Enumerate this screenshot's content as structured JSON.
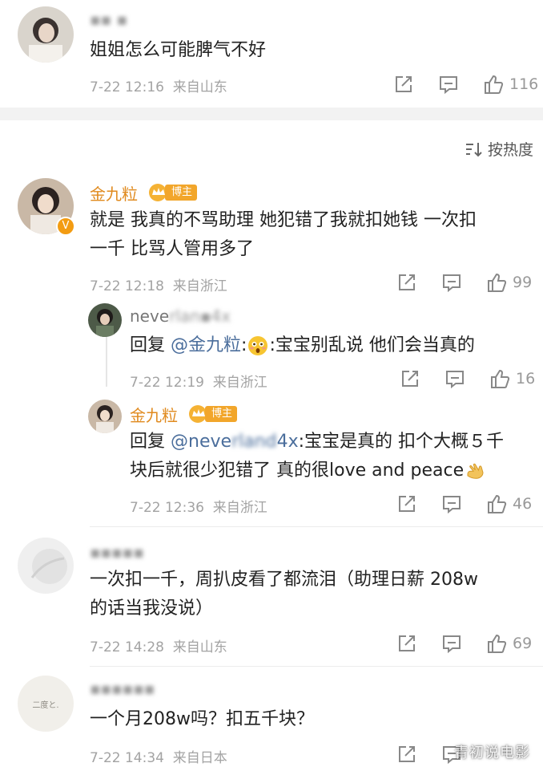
{
  "comments": [
    {
      "name_blurred": "▪▪ ▪",
      "text": "姐姐怎么可能脾气不好",
      "date": "7-22 12:16",
      "location": "来自山东",
      "likes": "116"
    },
    {
      "name": "金九粒",
      "badge": "博主",
      "lines": [
        "就是 我真的不骂助理 她犯错了我就扣她钱 一次扣",
        "一千 比骂人管用多了"
      ],
      "date": "7-22 12:18",
      "location": "来自浙江",
      "likes": "99",
      "replies": [
        {
          "name_visible": "neve",
          "name_blurred": "rlan▪4x",
          "reply_prefix": "回复 ",
          "reply_to": "@金九粒",
          "reply_text": ":宝宝别乱说 他们会当真的",
          "emoji": "flushed-face-emoji",
          "date": "7-22 12:19",
          "location": "来自浙江",
          "likes": "16"
        },
        {
          "name": "金九粒",
          "badge": "博主",
          "reply_prefix": "回复 ",
          "reply_to_visible": "@neve",
          "reply_to_blurred": "rland",
          "reply_to_tail": "4x",
          "reply_text": ":宝宝是真的 扣个大概５千",
          "line2": "块后就很少犯错了 真的很love and peace",
          "emoji": "ok-hand-emoji",
          "date": "7-22 12:36",
          "location": "来自浙江",
          "likes": "46"
        }
      ]
    },
    {
      "name_blurred": "▪▪▪▪▪",
      "lines": [
        "一次扣一千，周扒皮看了都流泪（助理日薪 208w",
        "的话当我没说）"
      ],
      "date": "7-22 14:28",
      "location": "来自山东",
      "likes": "69"
    },
    {
      "name_blurred": "▪▪▪▪▪▪",
      "text": "一个月208w吗？扣五千块？",
      "date": "7-22 14:34",
      "location": "来自日本",
      "likes": ""
    }
  ],
  "sort_label": "按热度",
  "watermark": "青初说电影",
  "icons": [
    "share-icon",
    "comment-icon",
    "like-icon",
    "sort-icon"
  ],
  "colors": {
    "name_orange": "#e08a1e",
    "mention_blue": "#4b6e9c",
    "meta_gray": "#a3a3a3",
    "separator": "#f2f2f2"
  }
}
